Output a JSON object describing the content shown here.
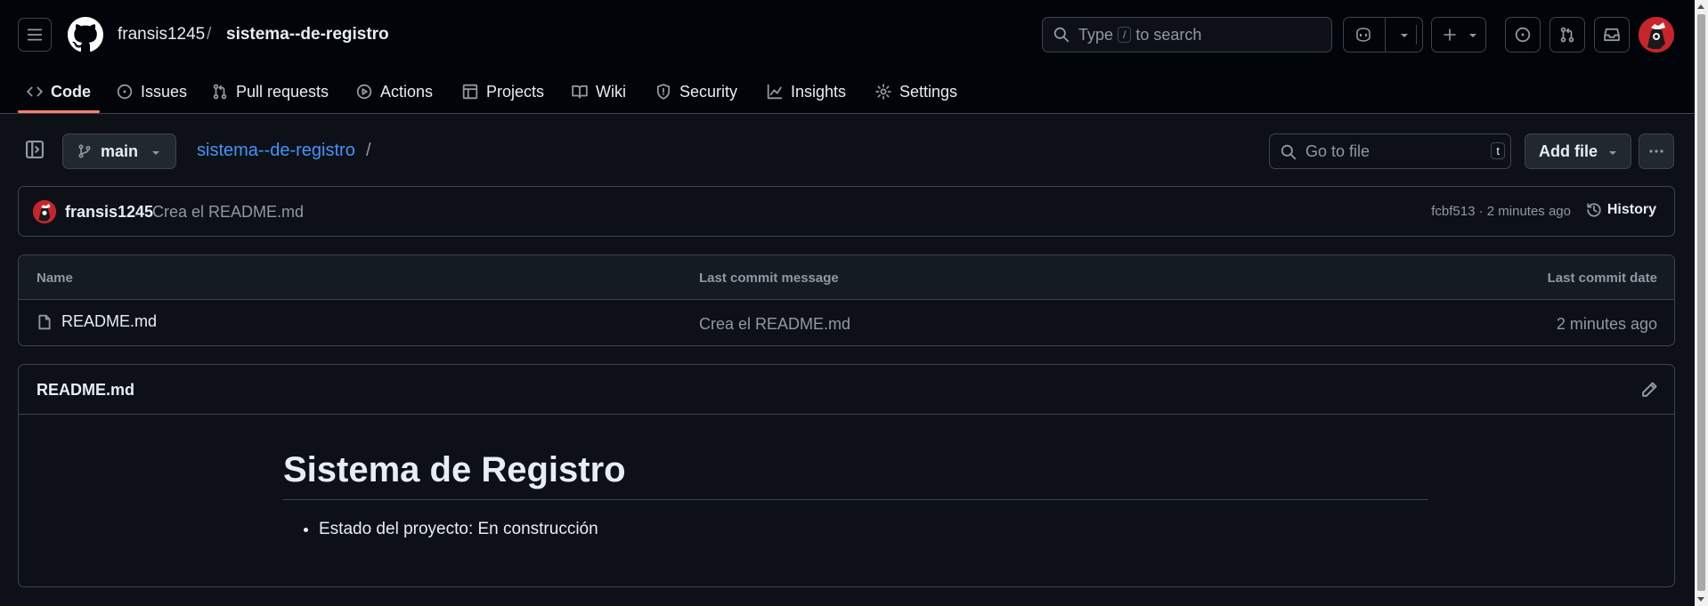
{
  "header": {
    "owner": "fransis1245",
    "separator": "/",
    "repo": "sistema--de-registro",
    "search": {
      "prefix": "Type",
      "key": "/",
      "suffix": "to search"
    }
  },
  "nav": {
    "tabs": [
      {
        "label": "Code",
        "icon": "code-icon",
        "active": true
      },
      {
        "label": "Issues",
        "icon": "issue-opened-icon"
      },
      {
        "label": "Pull requests",
        "icon": "git-pull-request-icon"
      },
      {
        "label": "Actions",
        "icon": "play-icon"
      },
      {
        "label": "Projects",
        "icon": "table-icon"
      },
      {
        "label": "Wiki",
        "icon": "book-icon"
      },
      {
        "label": "Security",
        "icon": "shield-icon"
      },
      {
        "label": "Insights",
        "icon": "graph-icon"
      },
      {
        "label": "Settings",
        "icon": "gear-icon"
      }
    ]
  },
  "repo_bar": {
    "branch": "main",
    "path_repo": "sistema--de-registro",
    "path_sep": "/",
    "goto_placeholder": "Go to file",
    "goto_key": "t",
    "add_file": "Add file"
  },
  "commit": {
    "author": "fransis1245",
    "message": "Crea el README.md",
    "meta": "fcbf513 · 2 minutes ago",
    "history": "History"
  },
  "files": {
    "columns": [
      "Name",
      "Last commit message",
      "Last commit date"
    ],
    "rows": [
      {
        "name": "README.md",
        "message": "Crea el README.md",
        "date": "2 minutes ago"
      }
    ]
  },
  "readme": {
    "title": "README.md",
    "heading": "Sistema de Registro",
    "items": [
      "Estado del proyecto: En construcción"
    ]
  },
  "colors": {
    "accent_link": "#4493f8",
    "tab_underline": "#f78166",
    "header_bg": "#010409",
    "page_bg": "#0d1117"
  }
}
